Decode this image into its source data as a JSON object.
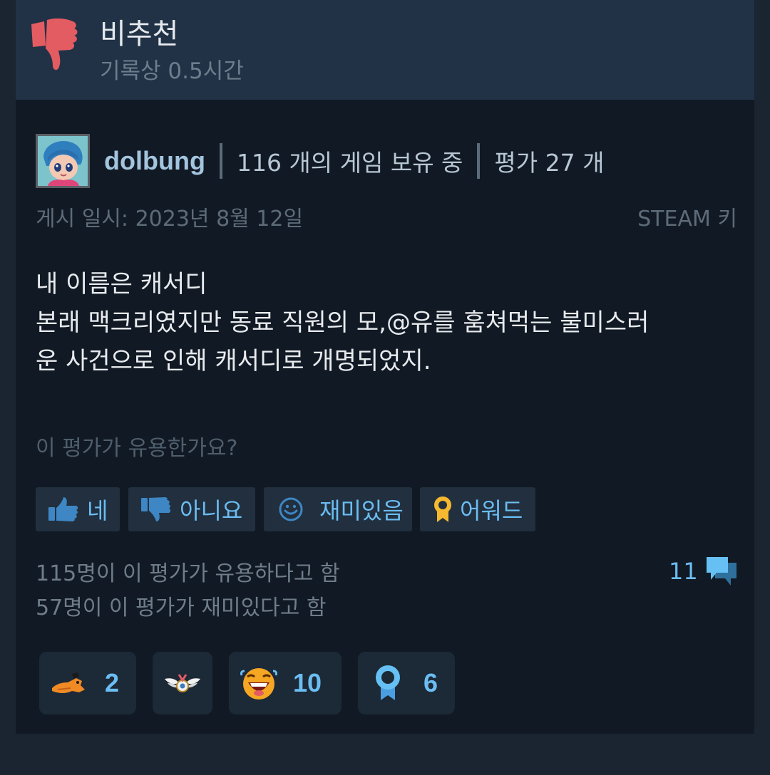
{
  "verdict": {
    "title": "비추천",
    "hours": "기록상 0.5시간",
    "icon": "thumbs-down-icon",
    "accent_color": "#e35c62"
  },
  "author": {
    "name": "dolbung",
    "games_owned": "116 개의 게임 보유 중",
    "reviews_count": "평가 27 개"
  },
  "post": {
    "date": "게시 일시: 2023년 8월 12일",
    "key_type": "STEAM 키"
  },
  "review": {
    "lines": [
      "내 이름은 캐서디",
      "본래 맥크리였지만 동료 직원의 모,@유를 훔쳐먹는 불미스러",
      "운 사건으로 인해 캐서디로 개명되었지."
    ]
  },
  "helpful": {
    "question": "이 평가가 유용한가요?",
    "buttons": {
      "yes": "네",
      "no": "아니요",
      "funny": "재미있음",
      "award": "어워드"
    }
  },
  "stats": {
    "helpful_count": "115명이 이 평가가 유용하다고 함",
    "funny_count": "57명이 이 평가가 재미있다고 함",
    "comment_count": "11"
  },
  "awards": [
    {
      "icon": "dragon-hand-award-icon",
      "count": "2"
    },
    {
      "icon": "winged-medal-award-icon",
      "count": ""
    },
    {
      "icon": "laughing-face-award-icon",
      "count": "10"
    },
    {
      "icon": "ribbon-award-icon",
      "count": "6"
    }
  ],
  "colors": {
    "background": "#111924",
    "header": "#213246",
    "link_blue": "#6bbdf2",
    "award_gold": "#f5b82e"
  }
}
